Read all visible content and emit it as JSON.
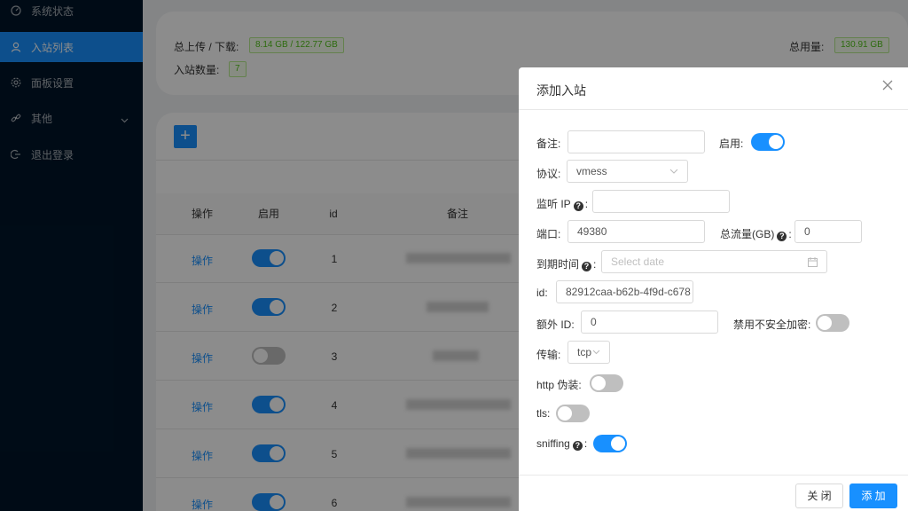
{
  "sidebar": {
    "items": [
      {
        "label": "系统状态",
        "icon": "dashboard-icon"
      },
      {
        "label": "入站列表",
        "icon": "user-icon"
      },
      {
        "label": "面板设置",
        "icon": "gear-icon"
      },
      {
        "label": "其他",
        "icon": "link-icon"
      },
      {
        "label": "退出登录",
        "icon": "logout-icon"
      }
    ]
  },
  "stats": {
    "upload_download_label": "总上传 / 下载:",
    "upload_download_value": "8.14 GB / 122.77 GB",
    "total_usage_label": "总用量:",
    "total_usage_value": "130.91 GB",
    "inbound_count_label": "入站数量:",
    "inbound_count_value": "7"
  },
  "toolbar": {
    "add_label": "+"
  },
  "table": {
    "headers": {
      "op": "操作",
      "enable": "启用",
      "id": "id",
      "remark": "备注"
    },
    "rows": [
      {
        "op": "操作",
        "enabled": true,
        "id": "1"
      },
      {
        "op": "操作",
        "enabled": true,
        "id": "2"
      },
      {
        "op": "操作",
        "enabled": false,
        "id": "3"
      },
      {
        "op": "操作",
        "enabled": true,
        "id": "4"
      },
      {
        "op": "操作",
        "enabled": true,
        "id": "5"
      },
      {
        "op": "操作",
        "enabled": true,
        "id": "6"
      }
    ]
  },
  "modal": {
    "title": "添加入站",
    "fields": {
      "remark_label": "备注:",
      "remark_value": "",
      "enable_label": "启用:",
      "enable_value": true,
      "protocol_label": "协议:",
      "protocol_value": "vmess",
      "listen_ip_label": "监听 IP",
      "listen_ip_value": "",
      "port_label": "端口:",
      "port_value": "49380",
      "total_flow_label": "总流量(GB)",
      "total_flow_value": "0",
      "expiry_label": "到期时间",
      "expiry_placeholder": "Select date",
      "id_label": "id:",
      "id_value": "82912caa-b62b-4f9d-c678",
      "alter_id_label": "额外 ID:",
      "alter_id_value": "0",
      "disable_insecure_label": "禁用不安全加密:",
      "disable_insecure_value": false,
      "transport_label": "传输:",
      "transport_value": "tcp",
      "http_camouflage_label": "http 伪装:",
      "http_camouflage_value": false,
      "tls_label": "tls:",
      "tls_value": false,
      "sniffing_label": "sniffing",
      "sniffing_value": true
    },
    "footer": {
      "close_label": "关 闭",
      "add_label": "添 加"
    }
  },
  "colors": {
    "accent": "#1890ff",
    "sidebar_bg": "#001529",
    "tag_green": "#52c41a"
  }
}
